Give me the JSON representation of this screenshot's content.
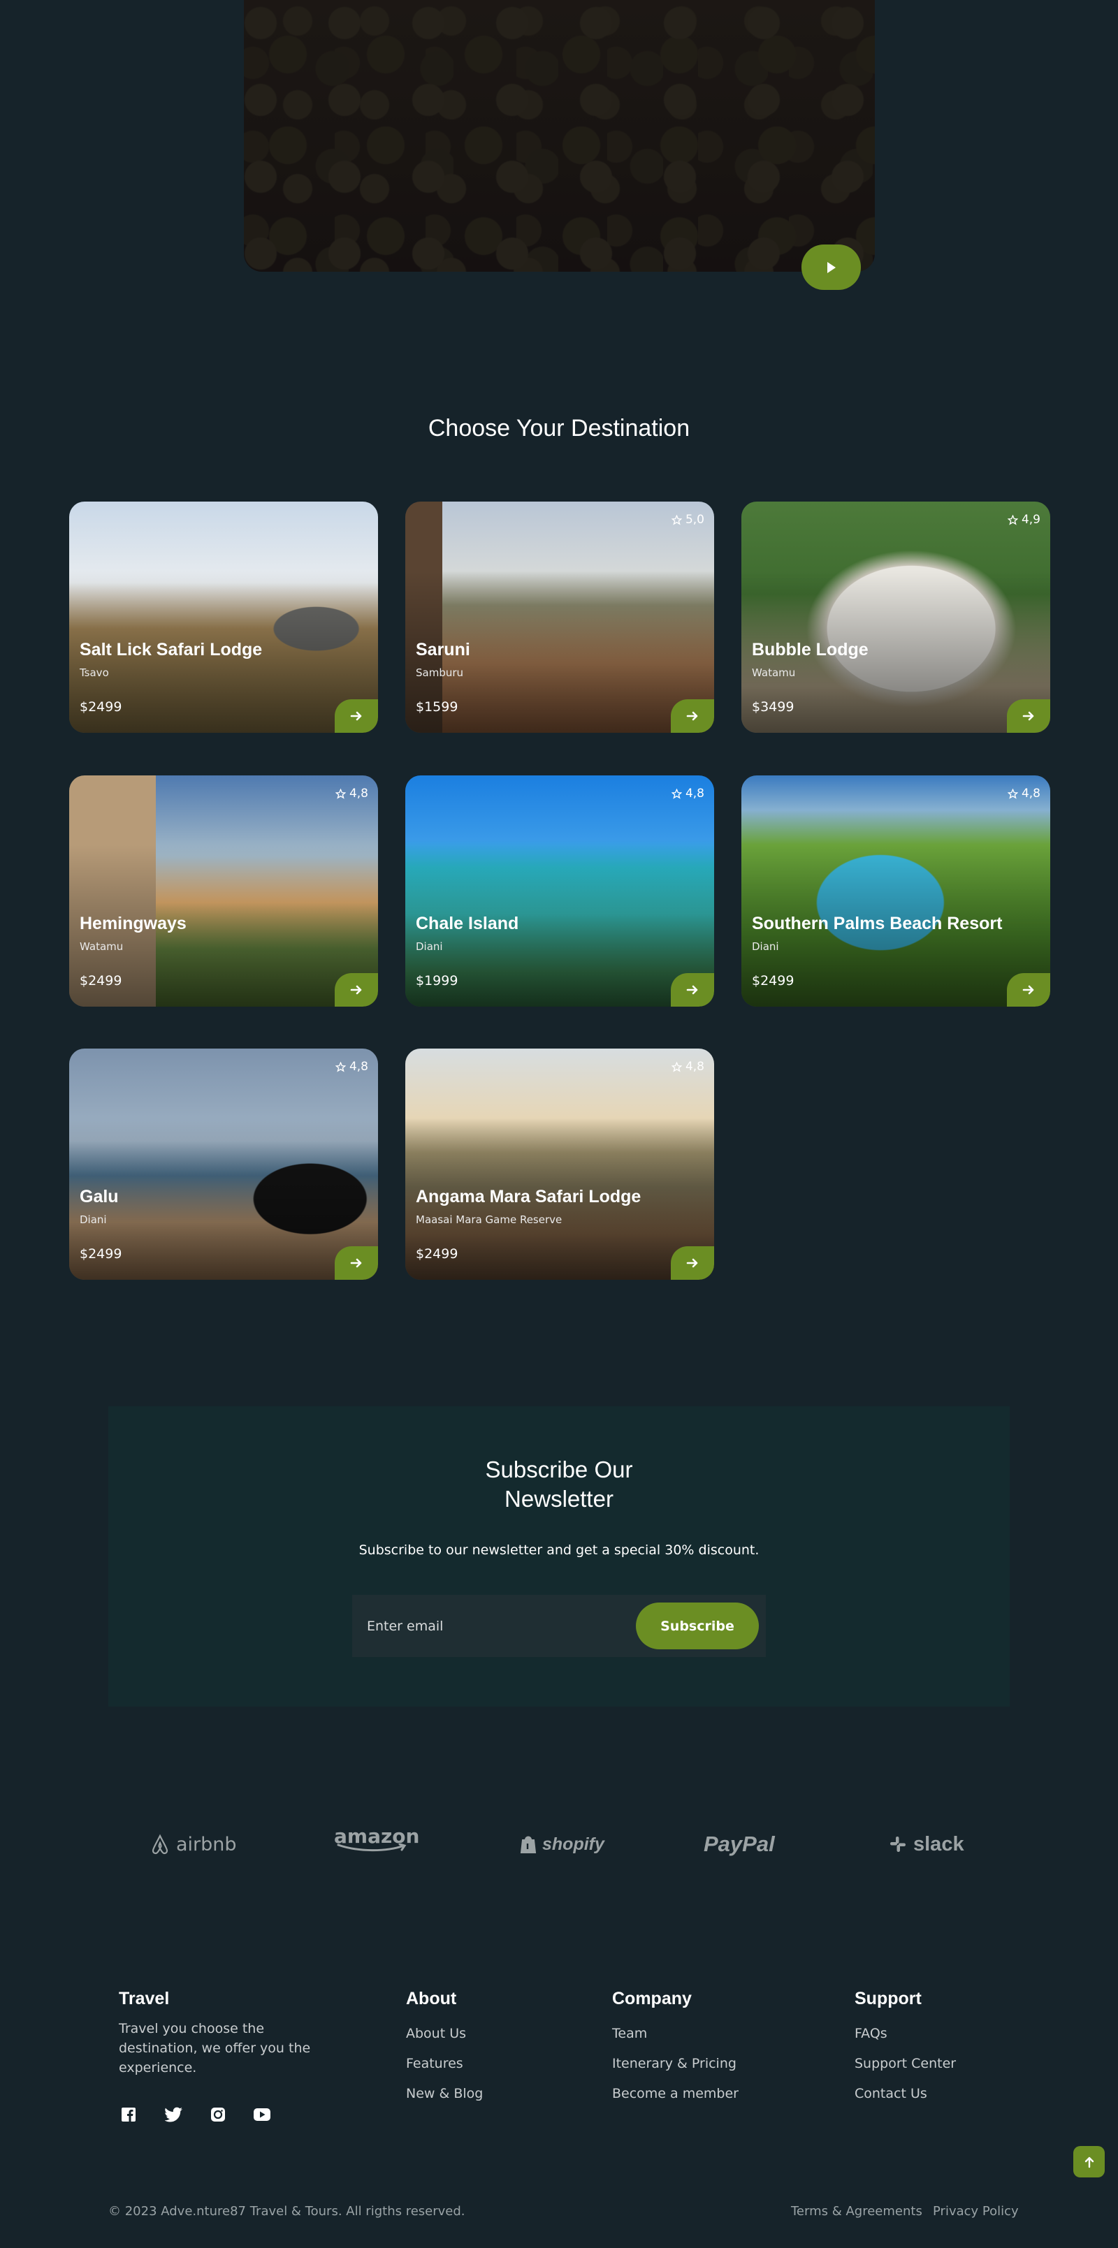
{
  "section_title": "Choose Your Destination",
  "cards": [
    {
      "name": "Salt Lick Safari Lodge",
      "location": "Tsavo",
      "price": "$2499",
      "rating": ""
    },
    {
      "name": "Saruni",
      "location": "Samburu",
      "price": "$1599",
      "rating": "5,0"
    },
    {
      "name": "Bubble Lodge",
      "location": "Watamu",
      "price": "$3499",
      "rating": "4,9"
    },
    {
      "name": "Hemingways",
      "location": "Watamu",
      "price": "$2499",
      "rating": "4,8"
    },
    {
      "name": "Chale Island",
      "location": "Diani",
      "price": "$1999",
      "rating": "4,8"
    },
    {
      "name": "Southern Palms Beach Resort",
      "location": "Diani",
      "price": "$2499",
      "rating": "4,8"
    },
    {
      "name": "Galu",
      "location": "Diani",
      "price": "$2499",
      "rating": "4,8"
    },
    {
      "name": "Angama Mara Safari Lodge",
      "location": "Maasai Mara Game Reserve",
      "price": "$2499",
      "rating": "4,8"
    }
  ],
  "newsletter": {
    "title_line1": "Subscribe Our",
    "title_line2": "Newsletter",
    "subtitle": "Subscribe to our newsletter and get a special 30% discount.",
    "placeholder": "Enter email",
    "button": "Subscribe"
  },
  "brands": [
    "airbnb",
    "amazon",
    "shopify",
    "PayPal",
    "slack"
  ],
  "footer": {
    "travel": {
      "title": "Travel",
      "desc": "Travel you choose the destination, we offer you the experience."
    },
    "about": {
      "title": "About",
      "links": [
        "About Us",
        "Features",
        "New & Blog"
      ]
    },
    "company": {
      "title": "Company",
      "links": [
        "Team",
        "Itenerary & Pricing",
        "Become a member"
      ]
    },
    "support": {
      "title": "Support",
      "links": [
        "FAQs",
        "Support Center",
        "Contact Us"
      ]
    },
    "copyright": "© 2023 Adve.nture87 Travel & Tours. All rigths reserved.",
    "terms": "Terms & Agreements",
    "privacy": "Privacy Policy"
  },
  "colors": {
    "accent": "#6b8e23",
    "background": "#16232a",
    "newsletter_bg": "#142a2e"
  },
  "icons": [
    "play-icon",
    "star-icon",
    "arrow-right-icon",
    "facebook-icon",
    "twitter-icon",
    "instagram-icon",
    "youtube-icon",
    "arrow-up-icon"
  ]
}
